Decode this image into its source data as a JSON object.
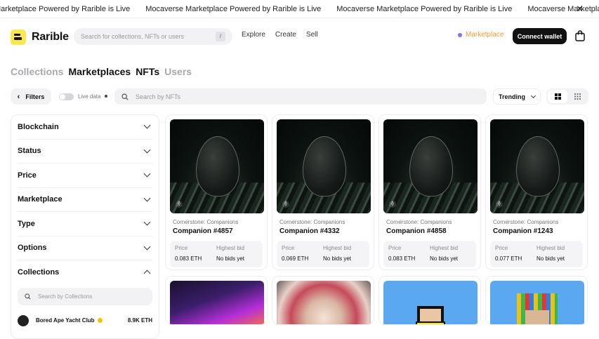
{
  "ticker": {
    "items": [
      "Marketplace Powered by Rarible is Live",
      "Mocaverse Marketplace Powered by Rarible is Live",
      "Mocaverse Marketplace Powered by Rarible is Live",
      "Mocaverse Marketplace Powered by Rar"
    ],
    "close_icon": "close-icon"
  },
  "header": {
    "logo_text": "Rarible",
    "search_placeholder": "Search for collections, NFTs or users",
    "search_shortcut": "/",
    "nav_links": [
      "Explore",
      "Create",
      "Sell"
    ],
    "marketplace_link": "Marketplace",
    "connect_wallet": "Connect wallet",
    "bag_icon": "shopping-bag-icon"
  },
  "tabs": [
    {
      "label": "Collections",
      "active": false
    },
    {
      "label": "Marketplaces",
      "active": true
    },
    {
      "label": "NFTs",
      "active": true
    },
    {
      "label": "Users",
      "active": false
    }
  ],
  "toolbar": {
    "filters_label": "Filters",
    "live_data_label": "Live data",
    "nft_search_placeholder": "Search by NFTs",
    "sort_label": "Trending"
  },
  "sidebar": {
    "facets": [
      "Blockchain",
      "Status",
      "Price",
      "Marketplace",
      "Type",
      "Options",
      "Collections"
    ],
    "collections_search_placeholder": "Search by Collections",
    "collections": [
      {
        "name": "Bored Ape Yacht Club",
        "volume": "8.9K ETH"
      }
    ]
  },
  "cards": [
    {
      "collection": "Cornerstone: Companions",
      "title": "Companion #4857",
      "price_label": "Price",
      "price": "0.083 ETH",
      "bid_label": "Highest bid",
      "bid": "No bids yet"
    },
    {
      "collection": "Cornerstone: Companions",
      "title": "Companion #4332",
      "price_label": "Price",
      "price": "0.069 ETH",
      "bid_label": "Highest bid",
      "bid": "No bids yet"
    },
    {
      "collection": "Cornerstone: Companions",
      "title": "Companion #4858",
      "price_label": "Price",
      "price": "0.083 ETH",
      "bid_label": "Highest bid",
      "bid": "No bids yet"
    },
    {
      "collection": "Cornerstone: Companions",
      "title": "Companion #1243",
      "price_label": "Price",
      "price": "0.077 ETH",
      "bid_label": "Highest bid",
      "bid": "No bids yet"
    }
  ]
}
